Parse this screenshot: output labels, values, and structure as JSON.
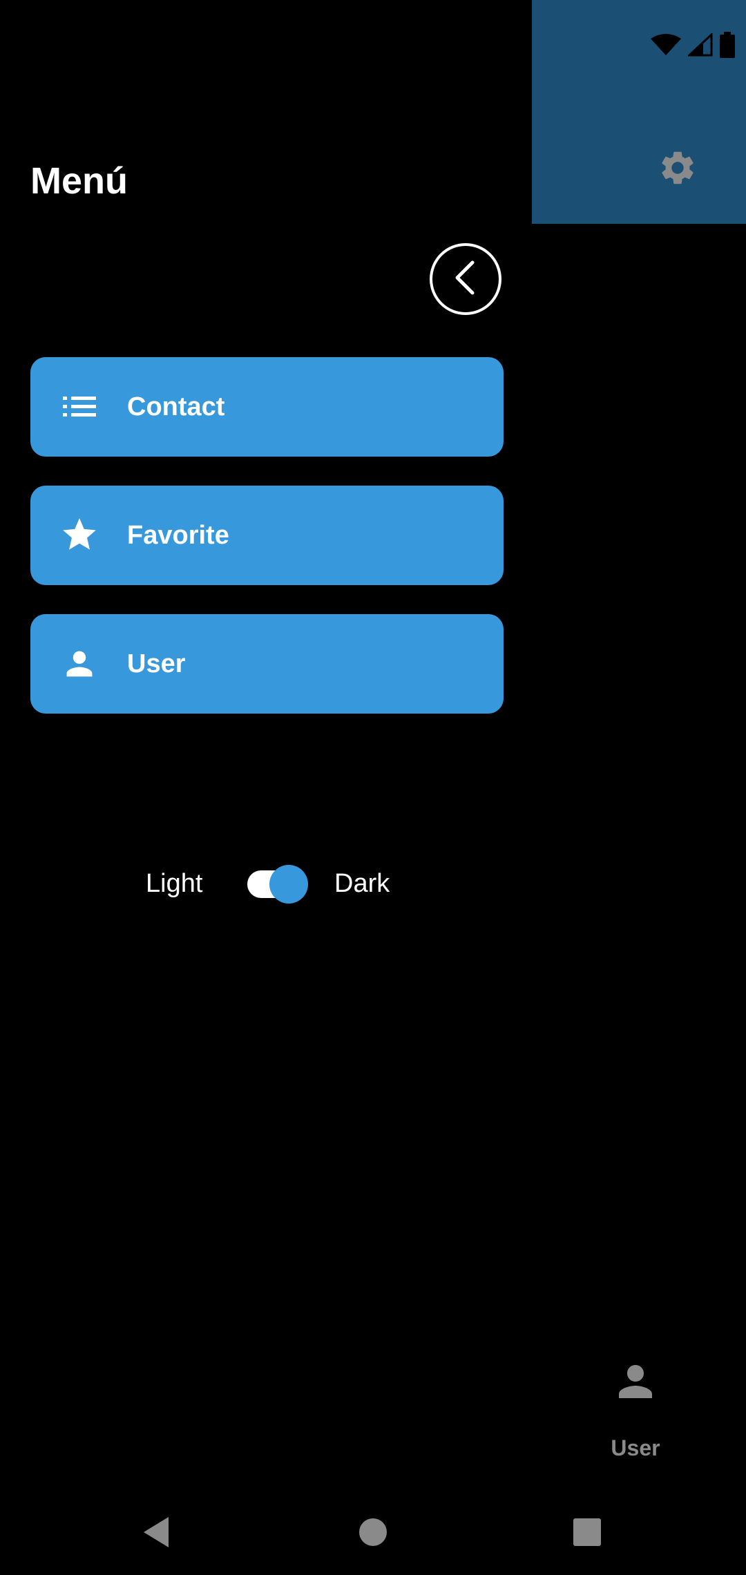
{
  "drawer": {
    "title": "Menú",
    "items": [
      {
        "label": "Contact",
        "icon": "list-icon"
      },
      {
        "label": "Favorite",
        "icon": "star-icon"
      },
      {
        "label": "User",
        "icon": "person-icon"
      }
    ],
    "theme": {
      "light_label": "Light",
      "dark_label": "Dark",
      "dark_enabled": true
    }
  },
  "bottom_nav": {
    "user_label": "User"
  },
  "colors": {
    "accent": "#3898dc",
    "header": "#1b4f74",
    "background": "#000000",
    "text": "#ffffff",
    "muted": "#8a8a8a"
  },
  "icons": {
    "header": "gear-icon",
    "close": "chevron-left-icon",
    "status": [
      "wifi-icon",
      "cell-signal-icon",
      "battery-icon"
    ],
    "system_nav": [
      "back-triangle-icon",
      "home-circle-icon",
      "recents-square-icon"
    ]
  }
}
